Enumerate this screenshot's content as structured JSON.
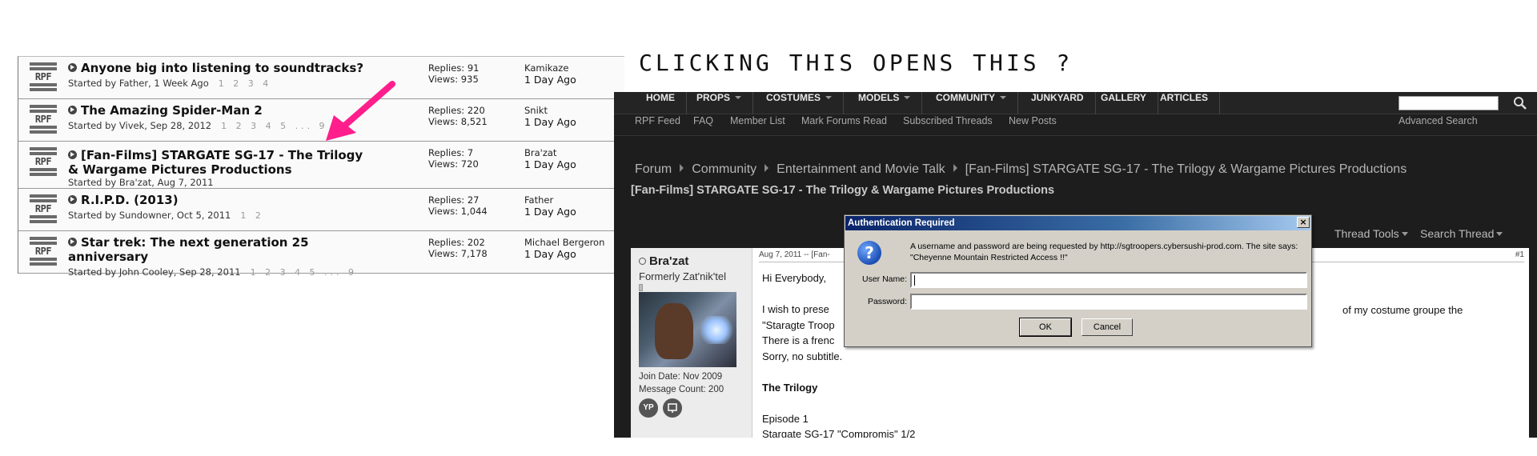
{
  "threads": [
    {
      "title": "Anyone big into listening to soundtracks?",
      "started": "Started by Father, 1 Week Ago",
      "pages": "1 2 3 4",
      "replies": "Replies: 91",
      "views": "Views: 935",
      "last_user": "Kamikaze",
      "last_time": "1 Day Ago"
    },
    {
      "title": "The Amazing Spider-Man 2",
      "started": "Started by Vivek, Sep 28, 2012",
      "pages": "1 2 3 4 5 ... 9",
      "replies": "Replies: 220",
      "views": "Views: 8,521",
      "last_user": "Snikt",
      "last_time": "1 Day Ago"
    },
    {
      "title": "[Fan-Films] STARGATE SG-17 - The Trilogy & Wargame Pictures Productions",
      "started": "Started by Bra'zat, Aug 7, 2011",
      "pages": "",
      "replies": "Replies: 7",
      "views": "Views: 720",
      "last_user": "Bra'zat",
      "last_time": "1 Day Ago"
    },
    {
      "title": "R.I.P.D. (2013)",
      "started": "Started by Sundowner, Oct 5, 2011",
      "pages": "1 2",
      "replies": "Replies: 27",
      "views": "Views: 1,044",
      "last_user": "Father",
      "last_time": "1 Day Ago"
    },
    {
      "title": "Star trek: The next generation 25 anniversary",
      "started": "Started by John Cooley, Sep 28, 2011",
      "pages": "1 2 3 4 5 ... 9",
      "replies": "Replies: 202",
      "views": "Views: 7,178",
      "last_user": "Michael Bergeron",
      "last_time": "1 Day Ago"
    }
  ],
  "rpf_icon_text": "RPF",
  "heading": "CLICKING THIS OPENS THIS ?",
  "forum": {
    "nav": [
      "HOME",
      "PROPS",
      "COSTUMES",
      "MODELS",
      "COMMUNITY",
      "JUNKYARD",
      "GALLERY",
      "ARTICLES"
    ],
    "subnav": [
      "RPF Feed",
      "FAQ",
      "Member List",
      "Mark Forums Read",
      "Subscribed Threads",
      "New Posts"
    ],
    "advanced_search": "Advanced Search",
    "breadcrumb": [
      "Forum",
      "Community",
      "Entertainment and Movie Talk",
      "[Fan-Films] STARGATE SG-17 - The Trilogy & Wargame Pictures Productions"
    ],
    "thread_title": "[Fan-Films] STARGATE SG-17 - The Trilogy & Wargame Pictures Productions",
    "thread_tools": "Thread Tools",
    "search_thread": "Search Thread",
    "post": {
      "username": "Bra'zat",
      "user_title": "Formerly Zat'nik'tel",
      "join_date": "Join Date: Nov 2009",
      "message_count": "Message Count: 200",
      "icon_1": "YP",
      "date": "Aug 7, 2011 -- [Fan-",
      "number": "#1",
      "lines": [
        "Hi Everybody,",
        "",
        "I wish to prese",
        "\"Staragte Troop",
        "There is a frenc",
        "Sorry, no subtitle.",
        "",
        "The Trilogy",
        "",
        "Episode 1",
        "Stargate SG-17 \"Compromis\" 1/2"
      ],
      "line_right": "of my costume groupe the"
    }
  },
  "dialog": {
    "title": "Authentication Required",
    "close": "×",
    "message": "A username and password are being requested by http://sgtroopers.cybersushi-prod.com. The site says: \"Cheyenne Mountain Restricted Access !!\"",
    "username_label": "User Name:",
    "password_label": "Password:",
    "ok": "OK",
    "cancel": "Cancel"
  },
  "colors": {
    "arrow": "#ff1e8c",
    "dialog_title": "#0a246a"
  }
}
